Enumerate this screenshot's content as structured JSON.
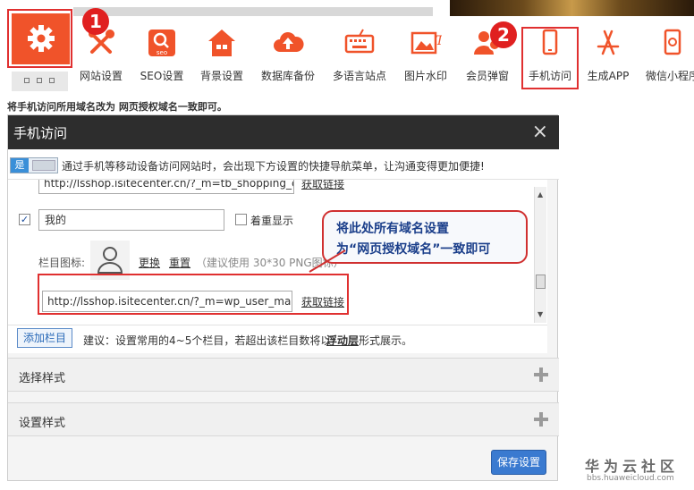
{
  "toolbar": {
    "items": [
      {
        "label": "网站设置",
        "icon": "wrench-screwdriver-icon"
      },
      {
        "label": "SEO设置",
        "icon": "seo-magnifier-icon"
      },
      {
        "label": "背景设置",
        "icon": "house-icon"
      },
      {
        "label": "数据库备份",
        "icon": "cloud-upload-icon"
      },
      {
        "label": "多语言站点",
        "icon": "keyboard-icon"
      },
      {
        "label": "图片水印",
        "icon": "image-watermark-icon"
      },
      {
        "label": "会员弹窗",
        "icon": "members-icon"
      },
      {
        "label": "手机访问",
        "icon": "mobile-phone-icon"
      },
      {
        "label": "生成APP",
        "icon": "app-store-icon"
      },
      {
        "label": "微信小程序",
        "icon": "mini-program-icon"
      }
    ],
    "badge1": "1",
    "badge2": "2"
  },
  "note": "将手机访问所用域名改为 网页授权域名一致即可。",
  "dialog": {
    "title": "手机访问",
    "close": "×",
    "toggle_label": "是",
    "intro": "通过手机等移动设备访问网站时，会出现下方设置的快捷导航菜单，让沟通变得更加便捷!",
    "prev_url": "http://lsshop.isitecenter.cn/?_m=tb_shopping_c",
    "prev_link": "获取链接",
    "check_mark": "✓",
    "item_name": "我的",
    "bold_label": "着重显示",
    "icon_label": "栏目图标:",
    "change_link": "更换",
    "reset_link": "重置",
    "icon_hint": "（建议使用 30*30 PNG图标）",
    "url_value": "http://lsshop.isitecenter.cn/?_m=wp_user_man",
    "get_link": "获取链接",
    "add_button": "添加栏目",
    "suggest_prefix": "建议：设置常用的4~5个栏目，若超出该栏目数将以",
    "suggest_link": "浮动层",
    "suggest_suffix": "形式展示。",
    "section1": "选择样式",
    "section2": "设置样式",
    "save": "保存设置"
  },
  "callout": {
    "line1": "将此处所有域名设置",
    "line2": "为“网页授权域名”一致即可"
  },
  "watermark": {
    "name": "华为云社区",
    "url": "bbs.huaweicloud.com"
  },
  "colors": {
    "accent_orange": "#f0532a",
    "highlight_red": "#e03030",
    "primary_blue": "#3a7ad0",
    "header_dark": "#2d2d2d"
  }
}
